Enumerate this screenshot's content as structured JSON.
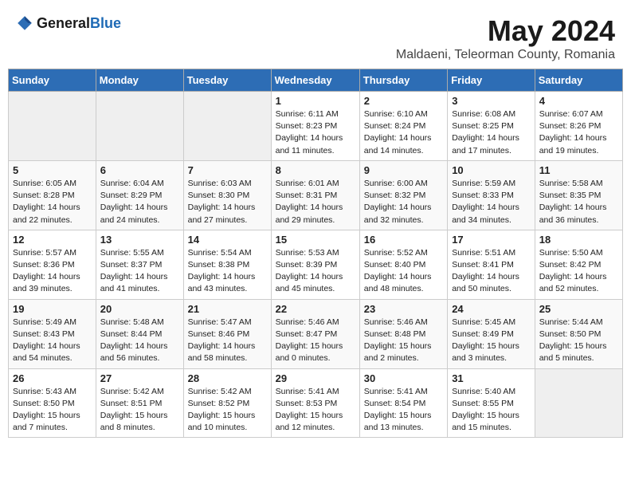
{
  "header": {
    "logo_general": "General",
    "logo_blue": "Blue",
    "title": "May 2024",
    "location": "Maldaeni, Teleorman County, Romania"
  },
  "weekdays": [
    "Sunday",
    "Monday",
    "Tuesday",
    "Wednesday",
    "Thursday",
    "Friday",
    "Saturday"
  ],
  "weeks": [
    [
      {
        "day": "",
        "info": ""
      },
      {
        "day": "",
        "info": ""
      },
      {
        "day": "",
        "info": ""
      },
      {
        "day": "1",
        "info": "Sunrise: 6:11 AM\nSunset: 8:23 PM\nDaylight: 14 hours\nand 11 minutes."
      },
      {
        "day": "2",
        "info": "Sunrise: 6:10 AM\nSunset: 8:24 PM\nDaylight: 14 hours\nand 14 minutes."
      },
      {
        "day": "3",
        "info": "Sunrise: 6:08 AM\nSunset: 8:25 PM\nDaylight: 14 hours\nand 17 minutes."
      },
      {
        "day": "4",
        "info": "Sunrise: 6:07 AM\nSunset: 8:26 PM\nDaylight: 14 hours\nand 19 minutes."
      }
    ],
    [
      {
        "day": "5",
        "info": "Sunrise: 6:05 AM\nSunset: 8:28 PM\nDaylight: 14 hours\nand 22 minutes."
      },
      {
        "day": "6",
        "info": "Sunrise: 6:04 AM\nSunset: 8:29 PM\nDaylight: 14 hours\nand 24 minutes."
      },
      {
        "day": "7",
        "info": "Sunrise: 6:03 AM\nSunset: 8:30 PM\nDaylight: 14 hours\nand 27 minutes."
      },
      {
        "day": "8",
        "info": "Sunrise: 6:01 AM\nSunset: 8:31 PM\nDaylight: 14 hours\nand 29 minutes."
      },
      {
        "day": "9",
        "info": "Sunrise: 6:00 AM\nSunset: 8:32 PM\nDaylight: 14 hours\nand 32 minutes."
      },
      {
        "day": "10",
        "info": "Sunrise: 5:59 AM\nSunset: 8:33 PM\nDaylight: 14 hours\nand 34 minutes."
      },
      {
        "day": "11",
        "info": "Sunrise: 5:58 AM\nSunset: 8:35 PM\nDaylight: 14 hours\nand 36 minutes."
      }
    ],
    [
      {
        "day": "12",
        "info": "Sunrise: 5:57 AM\nSunset: 8:36 PM\nDaylight: 14 hours\nand 39 minutes."
      },
      {
        "day": "13",
        "info": "Sunrise: 5:55 AM\nSunset: 8:37 PM\nDaylight: 14 hours\nand 41 minutes."
      },
      {
        "day": "14",
        "info": "Sunrise: 5:54 AM\nSunset: 8:38 PM\nDaylight: 14 hours\nand 43 minutes."
      },
      {
        "day": "15",
        "info": "Sunrise: 5:53 AM\nSunset: 8:39 PM\nDaylight: 14 hours\nand 45 minutes."
      },
      {
        "day": "16",
        "info": "Sunrise: 5:52 AM\nSunset: 8:40 PM\nDaylight: 14 hours\nand 48 minutes."
      },
      {
        "day": "17",
        "info": "Sunrise: 5:51 AM\nSunset: 8:41 PM\nDaylight: 14 hours\nand 50 minutes."
      },
      {
        "day": "18",
        "info": "Sunrise: 5:50 AM\nSunset: 8:42 PM\nDaylight: 14 hours\nand 52 minutes."
      }
    ],
    [
      {
        "day": "19",
        "info": "Sunrise: 5:49 AM\nSunset: 8:43 PM\nDaylight: 14 hours\nand 54 minutes."
      },
      {
        "day": "20",
        "info": "Sunrise: 5:48 AM\nSunset: 8:44 PM\nDaylight: 14 hours\nand 56 minutes."
      },
      {
        "day": "21",
        "info": "Sunrise: 5:47 AM\nSunset: 8:46 PM\nDaylight: 14 hours\nand 58 minutes."
      },
      {
        "day": "22",
        "info": "Sunrise: 5:46 AM\nSunset: 8:47 PM\nDaylight: 15 hours\nand 0 minutes."
      },
      {
        "day": "23",
        "info": "Sunrise: 5:46 AM\nSunset: 8:48 PM\nDaylight: 15 hours\nand 2 minutes."
      },
      {
        "day": "24",
        "info": "Sunrise: 5:45 AM\nSunset: 8:49 PM\nDaylight: 15 hours\nand 3 minutes."
      },
      {
        "day": "25",
        "info": "Sunrise: 5:44 AM\nSunset: 8:50 PM\nDaylight: 15 hours\nand 5 minutes."
      }
    ],
    [
      {
        "day": "26",
        "info": "Sunrise: 5:43 AM\nSunset: 8:50 PM\nDaylight: 15 hours\nand 7 minutes."
      },
      {
        "day": "27",
        "info": "Sunrise: 5:42 AM\nSunset: 8:51 PM\nDaylight: 15 hours\nand 8 minutes."
      },
      {
        "day": "28",
        "info": "Sunrise: 5:42 AM\nSunset: 8:52 PM\nDaylight: 15 hours\nand 10 minutes."
      },
      {
        "day": "29",
        "info": "Sunrise: 5:41 AM\nSunset: 8:53 PM\nDaylight: 15 hours\nand 12 minutes."
      },
      {
        "day": "30",
        "info": "Sunrise: 5:41 AM\nSunset: 8:54 PM\nDaylight: 15 hours\nand 13 minutes."
      },
      {
        "day": "31",
        "info": "Sunrise: 5:40 AM\nSunset: 8:55 PM\nDaylight: 15 hours\nand 15 minutes."
      },
      {
        "day": "",
        "info": ""
      }
    ]
  ]
}
